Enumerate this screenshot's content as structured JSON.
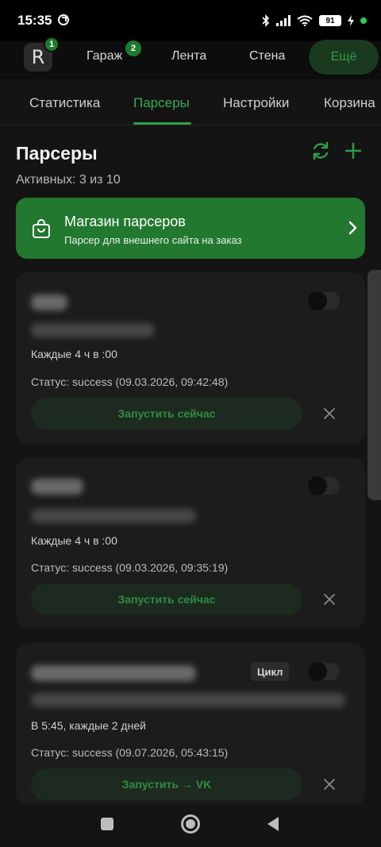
{
  "status_bar": {
    "time": "15:35",
    "battery": "91",
    "icons": [
      "clock-icon",
      "bluetooth-icon",
      "signal-icon",
      "wifi-icon",
      "battery-icon",
      "charging-icon",
      "dot-icon"
    ]
  },
  "top_nav": {
    "avatar_letter": "R",
    "avatar_badge": "1",
    "items": [
      {
        "label": "Гараж",
        "badge": "2"
      },
      {
        "label": "Лента"
      },
      {
        "label": "Стена"
      }
    ],
    "more_label": "Ещё"
  },
  "tabs": [
    {
      "label": "Статистика"
    },
    {
      "label": "Парсеры",
      "active": true
    },
    {
      "label": "Настройки"
    },
    {
      "label": "Корзина"
    }
  ],
  "page": {
    "title": "Парсеры",
    "active_count": "Активных: 3 из 10"
  },
  "store": {
    "title": "Магазин парсеров",
    "subtitle": "Парсер для внешнего сайта на заказ"
  },
  "parsers": [
    {
      "schedule": "Каждые 4 ч в :00",
      "status": "Статус: success (09.03.2026, 09:42:48)",
      "run_label": "Запустить сейчас",
      "enabled": false
    },
    {
      "schedule": "Каждые 4 ч в :00",
      "status": "Статус: success (09.03.2026, 09:35:19)",
      "run_label": "Запустить сейчас",
      "enabled": false
    },
    {
      "tag": "Цикл",
      "schedule": "В 5:45, каждые 2 дней",
      "status": "Статус: success (09.07.2026, 05:43:15)",
      "run_label": "Запустить → VK",
      "enabled": false
    }
  ],
  "colors": {
    "accent": "#2e9e48",
    "banner": "#22782f",
    "background": "#141414",
    "card": "#1c1c1c"
  }
}
